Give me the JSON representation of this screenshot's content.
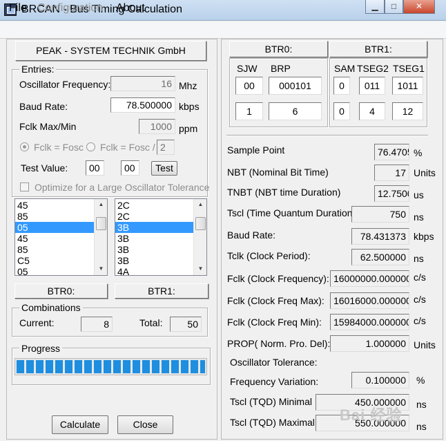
{
  "window": {
    "title": "BRCAN - Bus Timing Calculation",
    "minimize_glyph": "▁",
    "maximize_glyph": "□",
    "close_glyph": "✕"
  },
  "menu": {
    "file": "File",
    "configuration": "Configuration",
    "about": "About"
  },
  "company_label": "PEAK - SYSTEM TECHNIK GmbH",
  "entries": {
    "title": "Entries:",
    "osc_freq_label": "Oscillator Frequency:",
    "osc_freq_value": "16",
    "osc_freq_unit": "Mhz",
    "baud_label": "Baud Rate:",
    "baud_value": "78.500000",
    "baud_unit": "kbps",
    "fclk_max_label": "Fclk Max/Min",
    "fclk_max_value": "1000",
    "fclk_max_unit": "ppm",
    "radio1_label": "Fclk = Fosc",
    "radio2_label": "Fclk = Fosc /",
    "divider_value": "2",
    "test_label": "Test Value:",
    "test_value1": "00",
    "test_value2": "00",
    "test_button": "Test",
    "optimize_label": "Optimize for a Large Oscillator Tolerance"
  },
  "btr0_list": [
    "45",
    "85",
    "05",
    "45",
    "85",
    "C5",
    "05"
  ],
  "btr0_selected": 2,
  "btr1_list": [
    "2C",
    "2C",
    "3B",
    "3B",
    "3B",
    "3B",
    "4A"
  ],
  "btr1_selected": 2,
  "btr0_label": "BTR0:",
  "btr1_label": "BTR1:",
  "combinations": {
    "title": "Combinations",
    "current_label": "Current:",
    "current_value": "8",
    "total_label": "Total:",
    "total_value": "50"
  },
  "progress": {
    "title": "Progress",
    "fraction": 1.0
  },
  "buttons": {
    "calculate": "Calculate",
    "close": "Close"
  },
  "btr_table": {
    "btr0_header": "BTR0:",
    "btr1_header": "BTR1:",
    "sjw_label": "SJW",
    "brp_label": "BRP",
    "sam_label": "SAM",
    "tseg2_label": "TSEG2",
    "tseg1_label": "TSEG1",
    "sjw_bin": "00",
    "brp_bin": "000101",
    "sam_bin": "0",
    "tseg2_bin": "011",
    "tseg1_bin": "1011",
    "sjw_dec": "1",
    "brp_dec": "6",
    "sam_dec": "0",
    "tseg2_dec": "4",
    "tseg1_dec": "12"
  },
  "results": {
    "sample_point_label": "Sample Point",
    "sample_point_value": "76.4705",
    "sample_point_unit": "%",
    "nbt_label": "NBT (Nominal Bit Time)",
    "nbt_value": "17",
    "nbt_unit": "Units",
    "tnbt_label": "TNBT (NBT time Duration)",
    "tnbt_value": "12.7500",
    "tnbt_unit": "us",
    "tscl_label": "Tscl (Time Quantum Duration)",
    "tscl_value": "750",
    "tscl_unit": "ns",
    "baud_label": "Baud Rate:",
    "baud_value": "78.431373",
    "baud_unit": "kbps",
    "tclk_label": "Tclk (Clock Period):",
    "tclk_value": "62.500000",
    "tclk_unit": "ns",
    "fclk_label": "Fclk (Clock Frequency):",
    "fclk_value": "16000000.000000",
    "fclk_unit": "c/s",
    "fclk_max_label": "Fclk (Clock Freq Max):",
    "fclk_max_value": "16016000.000000",
    "fclk_max_unit": "c/s",
    "fclk_min_label": "Fclk (Clock Freq Min):",
    "fclk_min_value": "15984000.000000",
    "fclk_min_unit": "c/s",
    "prop_label": "PROP( Norm. Pro. Del):",
    "prop_value": "1.000000",
    "prop_unit": "Units",
    "osc_tol_label": "Oscillator Tolerance:",
    "freq_var_label": "Frequency Variation:",
    "freq_var_value": "0.100000",
    "freq_var_unit": "%",
    "tqd_min_label": "Tscl (TQD) Minimal",
    "tqd_min_value": "450.000000",
    "tqd_min_unit": "ns",
    "tqd_max_label": "Tscl (TQD) Maximal",
    "tqd_max_value": "550.000000",
    "tqd_max_unit": "ns"
  },
  "watermark": "Bai 经验"
}
